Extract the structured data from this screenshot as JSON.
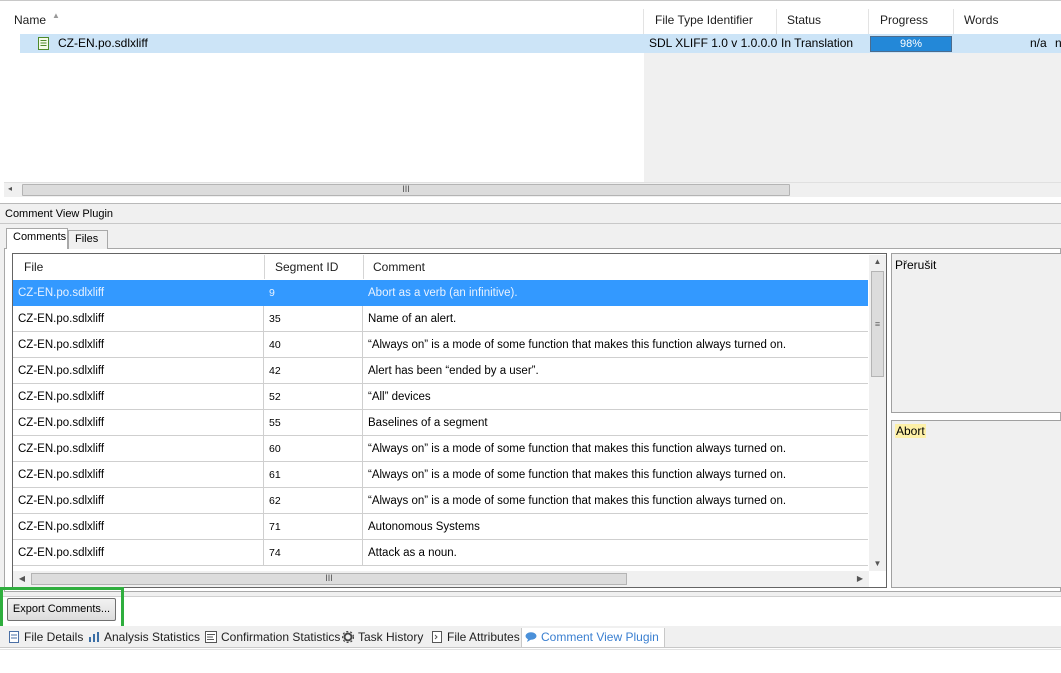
{
  "files_list": {
    "columns": [
      "Name",
      "File Type Identifier",
      "Status",
      "Progress",
      "Words"
    ],
    "file": {
      "name": "CZ-EN.po.sdlxliff",
      "file_type": "SDL XLIFF 1.0 v 1.0.0.0",
      "status": "In Translation",
      "progress_label": "98%",
      "progress_value": 98,
      "words": "n/a",
      "next_col_fragment": "n"
    },
    "scroll_grip": "III"
  },
  "plugin": {
    "title": "Comment View Plugin",
    "tabs": [
      "Comments",
      "Files"
    ],
    "grid": {
      "columns": [
        "File",
        "Segment ID",
        "Comment"
      ],
      "rows": [
        {
          "file": "CZ-EN.po.sdlxliff",
          "segment": "9",
          "comment": "Abort as a verb (an infinitive).",
          "selected": true
        },
        {
          "file": "CZ-EN.po.sdlxliff",
          "segment": "35",
          "comment": "Name of an alert."
        },
        {
          "file": "CZ-EN.po.sdlxliff",
          "segment": "40",
          "comment": "“Always on” is a mode of some function that makes this function always turned on."
        },
        {
          "file": "CZ-EN.po.sdlxliff",
          "segment": "42",
          "comment": "Alert has been “ended by a user”."
        },
        {
          "file": "CZ-EN.po.sdlxliff",
          "segment": "52",
          "comment": "“All” devices"
        },
        {
          "file": "CZ-EN.po.sdlxliff",
          "segment": "55",
          "comment": "Baselines of a segment"
        },
        {
          "file": "CZ-EN.po.sdlxliff",
          "segment": "60",
          "comment": "“Always on” is a mode of some function that makes this function always turned on."
        },
        {
          "file": "CZ-EN.po.sdlxliff",
          "segment": "61",
          "comment": "“Always on” is a mode of some function that makes this function always turned on."
        },
        {
          "file": "CZ-EN.po.sdlxliff",
          "segment": "62",
          "comment": "“Always on” is a mode of some function that makes this function always turned on."
        },
        {
          "file": "CZ-EN.po.sdlxliff",
          "segment": "71",
          "comment": "Autonomous Systems"
        },
        {
          "file": "CZ-EN.po.sdlxliff",
          "segment": "74",
          "comment": "Attack as a noun."
        }
      ]
    },
    "source_text": "Přerušit",
    "target_text": "Abort",
    "export_button": "Export Comments...",
    "scroll_grip": "III",
    "vscroll_grip": "≡"
  },
  "bottom_tabs": [
    {
      "label": "File Details",
      "icon": "file-details-icon"
    },
    {
      "label": "Analysis Statistics",
      "icon": "analysis-statistics-icon"
    },
    {
      "label": "Confirmation Statistics",
      "icon": "confirmation-statistics-icon"
    },
    {
      "label": "Task History",
      "icon": "task-history-gear-icon"
    },
    {
      "label": "File Attributes",
      "icon": "file-attributes-icon"
    },
    {
      "label": "Comment View Plugin",
      "icon": "comment-bubble-icon",
      "active": true
    }
  ],
  "colors": {
    "selection": "#3399ff",
    "file_row_selection": "#cce4f7",
    "progress_fill": "#2388d8",
    "highlight_box": "#2fae3e",
    "active_tab_text": "#3a7fd0"
  }
}
